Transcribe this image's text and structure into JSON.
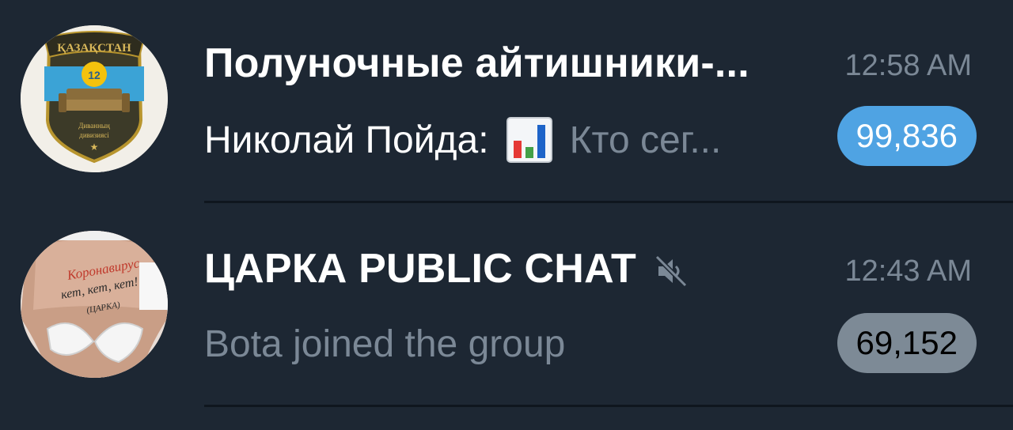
{
  "chats": [
    {
      "avatar_icon": "kazakhstan-divan-emblem-icon",
      "avatar_text_top": "ҚАЗАҚСТАН",
      "avatar_number": "12",
      "avatar_text_bottom1": "Диванның",
      "avatar_text_bottom2": "дивизиясі",
      "title": "Полуночные айтишники-...",
      "time": "12:58 AM",
      "sender": "Николай Пойда:",
      "message_icon": "bar-chart-emoji-icon",
      "message": "Кто сег...",
      "unread": "99,836",
      "muted": false
    },
    {
      "avatar_icon": "coronavirus-photo-icon",
      "avatar_text1": "Коронавирус",
      "avatar_text2": "кет, кет, кет!",
      "avatar_text3": "(ЦАРКА)",
      "title": "ЦАРКА PUBLIC CHAT",
      "title_icon": "muted-speaker-icon",
      "time": "12:43 AM",
      "message": "Bota joined the group",
      "unread": "69,152",
      "muted": true
    }
  ],
  "colors": {
    "background": "#1d2733",
    "secondary_text": "#7b8896",
    "badge_active": "#4fa3e3",
    "badge_muted": "#7d8a96"
  }
}
